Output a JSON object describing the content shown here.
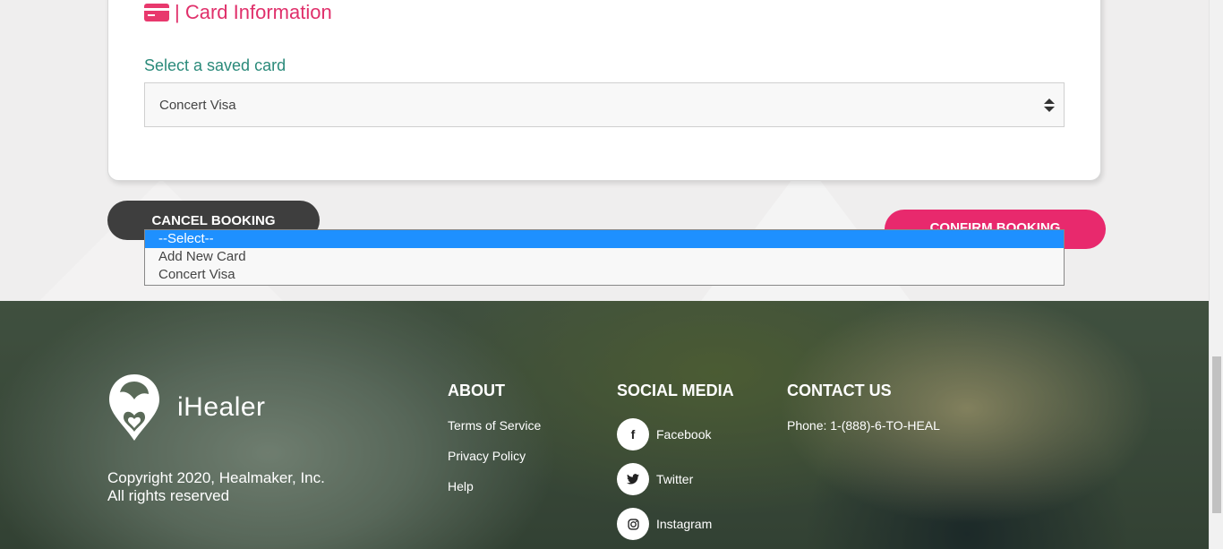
{
  "card": {
    "title": "| Card Information",
    "saved_label": "Select a saved card",
    "selected_value": "Concert Visa"
  },
  "dropdown": {
    "options": [
      "--Select--",
      "Add New Card",
      "Concert Visa"
    ]
  },
  "buttons": {
    "cancel": "CANCEL BOOKING",
    "confirm": "CONFIRM BOOKING"
  },
  "footer": {
    "brand": "iHealer",
    "copyright_line1": "Copyright 2020, Healmaker, Inc.",
    "copyright_line2": "All rights reserved",
    "about": {
      "heading": "ABOUT",
      "links": [
        "Terms of Service",
        "Privacy Policy",
        "Help"
      ]
    },
    "social": {
      "heading": "SOCIAL MEDIA",
      "items": [
        {
          "label": "Facebook",
          "icon": "facebook-icon"
        },
        {
          "label": "Twitter",
          "icon": "twitter-icon"
        },
        {
          "label": "Instagram",
          "icon": "instagram-icon"
        }
      ]
    },
    "contact": {
      "heading": "CONTACT US",
      "phone": "Phone: 1-(888)-6-TO-HEAL"
    }
  },
  "colors": {
    "accent_pink": "#e8296d",
    "label_teal": "#2a8a7a",
    "dark_button": "#3e3e3e",
    "dropdown_highlight": "#1e90ff"
  }
}
